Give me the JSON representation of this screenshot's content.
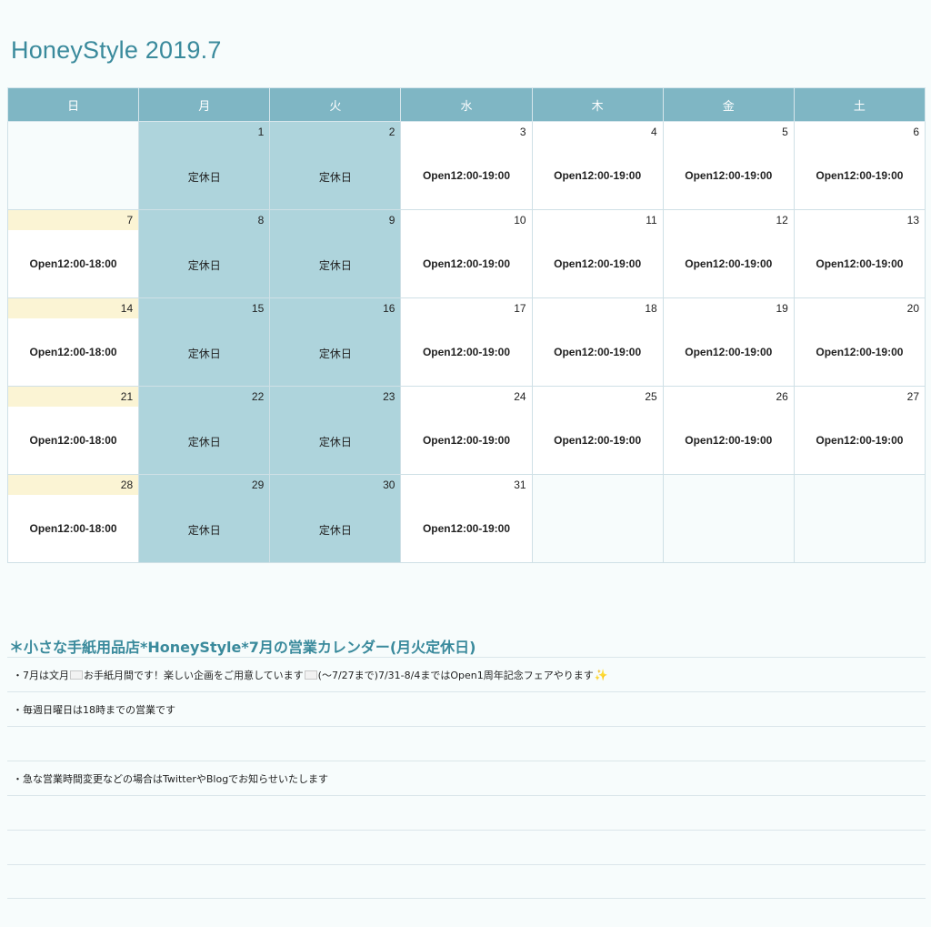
{
  "title": "HoneyStyle 2019.7",
  "weekdays": [
    "日",
    "月",
    "火",
    "水",
    "木",
    "金",
    "土"
  ],
  "labels": {
    "closed": "定休日",
    "weekday_hours": "Open12:00-19:00",
    "sunday_hours": "Open12:00-18:00"
  },
  "weeks": [
    [
      {
        "day": "",
        "label": "",
        "type": "blank"
      },
      {
        "day": "1",
        "label": "定休日",
        "type": "closed"
      },
      {
        "day": "2",
        "label": "定休日",
        "type": "closed"
      },
      {
        "day": "3",
        "label": "Open12:00-19:00",
        "type": "open"
      },
      {
        "day": "4",
        "label": "Open12:00-19:00",
        "type": "open"
      },
      {
        "day": "5",
        "label": "Open12:00-19:00",
        "type": "open"
      },
      {
        "day": "6",
        "label": "Open12:00-19:00",
        "type": "open"
      }
    ],
    [
      {
        "day": "7",
        "label": "Open12:00-18:00",
        "type": "sunday"
      },
      {
        "day": "8",
        "label": "定休日",
        "type": "closed"
      },
      {
        "day": "9",
        "label": "定休日",
        "type": "closed"
      },
      {
        "day": "10",
        "label": "Open12:00-19:00",
        "type": "open"
      },
      {
        "day": "11",
        "label": "Open12:00-19:00",
        "type": "open"
      },
      {
        "day": "12",
        "label": "Open12:00-19:00",
        "type": "open"
      },
      {
        "day": "13",
        "label": "Open12:00-19:00",
        "type": "open"
      }
    ],
    [
      {
        "day": "14",
        "label": "Open12:00-18:00",
        "type": "sunday"
      },
      {
        "day": "15",
        "label": "定休日",
        "type": "closed"
      },
      {
        "day": "16",
        "label": "定休日",
        "type": "closed"
      },
      {
        "day": "17",
        "label": "Open12:00-19:00",
        "type": "open"
      },
      {
        "day": "18",
        "label": "Open12:00-19:00",
        "type": "open"
      },
      {
        "day": "19",
        "label": "Open12:00-19:00",
        "type": "open"
      },
      {
        "day": "20",
        "label": "Open12:00-19:00",
        "type": "open"
      }
    ],
    [
      {
        "day": "21",
        "label": "Open12:00-18:00",
        "type": "sunday"
      },
      {
        "day": "22",
        "label": "定休日",
        "type": "closed"
      },
      {
        "day": "23",
        "label": "定休日",
        "type": "closed"
      },
      {
        "day": "24",
        "label": "Open12:00-19:00",
        "type": "open"
      },
      {
        "day": "25",
        "label": "Open12:00-19:00",
        "type": "open"
      },
      {
        "day": "26",
        "label": "Open12:00-19:00",
        "type": "open"
      },
      {
        "day": "27",
        "label": "Open12:00-19:00",
        "type": "open"
      }
    ],
    [
      {
        "day": "28",
        "label": "Open12:00-18:00",
        "type": "sunday"
      },
      {
        "day": "29",
        "label": "定休日",
        "type": "closed"
      },
      {
        "day": "30",
        "label": "定休日",
        "type": "closed"
      },
      {
        "day": "31",
        "label": "Open12:00-19:00",
        "type": "open"
      },
      {
        "day": "",
        "label": "",
        "type": "blank"
      },
      {
        "day": "",
        "label": "",
        "type": "blank"
      },
      {
        "day": "",
        "label": "",
        "type": "blank"
      }
    ]
  ],
  "section_heading": "＊小さな手紙用品店*HoneyStyle*7月の営業カレンダー(月火定休日)",
  "notes": {
    "line1": {
      "part1": "・7月は文月",
      "part2": "お手紙月間です！楽しい企画をご用意しています",
      "part3": "(〜7/27まで)7/31-8/4まではOpen1周年記念フェアやります"
    },
    "line2": "・毎週日曜日は18時までの営業です",
    "line3": "",
    "line4": "・急な営業時間変更などの場合はTwitterやBlogでお知らせいたします"
  },
  "icons": {
    "envelope": "envelope-icon",
    "sparkle": "sparkles-icon"
  },
  "colors": {
    "title": "#3a8a9c",
    "header_bg": "#7fb6c4",
    "closed_bg": "#aed4dc",
    "sunday_highlight": "#fbf4d4"
  }
}
